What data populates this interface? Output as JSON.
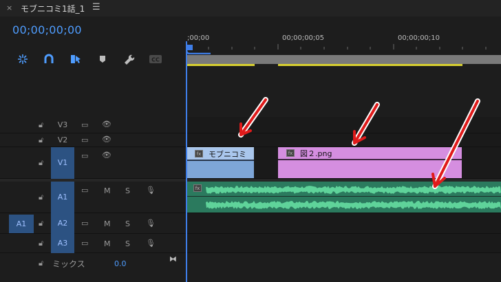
{
  "sequence": {
    "close_glyph": "×",
    "title": "モブニコミ1話_1",
    "menu_glyph": "☰",
    "timecode": "00;00;00;00"
  },
  "tools": [
    {
      "name": "ripple-edit-icon",
      "glyph": "✲"
    },
    {
      "name": "snap-icon",
      "glyph": "∩"
    },
    {
      "name": "linked-selection-icon",
      "glyph": "▶"
    },
    {
      "name": "add-marker-icon",
      "glyph": "⬟"
    },
    {
      "name": "wrench-icon",
      "glyph": "🔧"
    },
    {
      "name": "captions-icon",
      "glyph": "CC"
    }
  ],
  "ruler": {
    "ticks": [
      ";00;00",
      "00;00;00;05",
      "00;00;00;10"
    ]
  },
  "tracks": {
    "v3": {
      "label": "V3"
    },
    "v2": {
      "label": "V2"
    },
    "v1": {
      "label": "V1"
    },
    "a1": {
      "label": "A1"
    },
    "a2": {
      "label": "A2",
      "source": "A1"
    },
    "a3": {
      "label": "A3"
    },
    "mix": {
      "label": "ミックス",
      "value": "0.0"
    }
  },
  "audio_controls": {
    "mute": "M",
    "solo": "S"
  },
  "clips": {
    "v1_a": {
      "label": "モブニコミ",
      "fx": "fx"
    },
    "v1_b": {
      "label": "図２.png",
      "fx": "fx"
    },
    "a1": {
      "fx": "fx"
    }
  },
  "colors": {
    "accent": "#4f9dff",
    "video_clip": "#7ea6d8",
    "graphic_clip": "#d58ee0",
    "audio_clip": "#2b7a5e",
    "arrow": "#e01b1b"
  }
}
